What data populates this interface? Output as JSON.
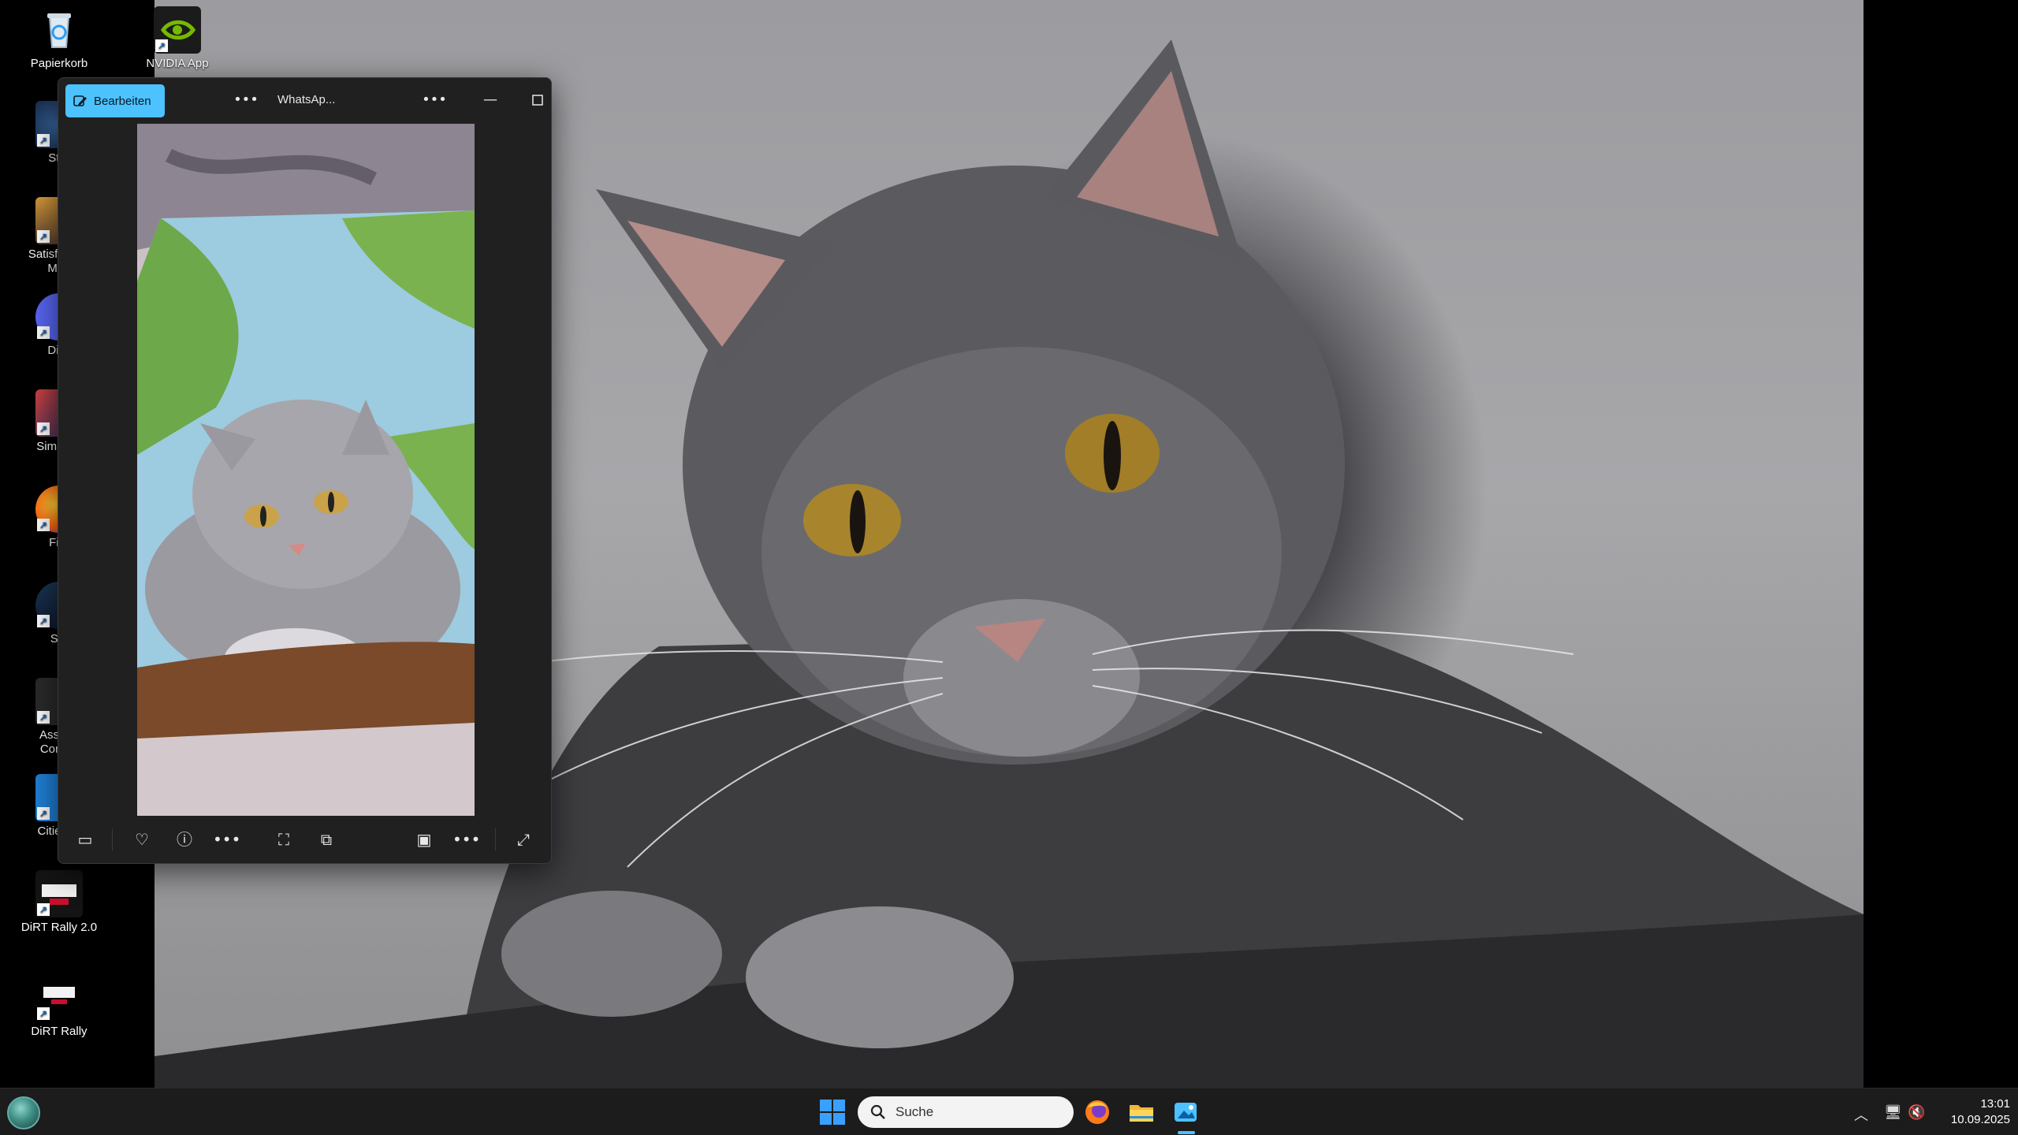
{
  "desktop": {
    "icons": [
      {
        "label": "Papierkorb",
        "icon": "recycle-bin-icon"
      },
      {
        "label": "NVIDIA App",
        "icon": "nvidia-icon"
      },
      {
        "label": "Star",
        "icon": "star-citizen-icon"
      },
      {
        "label": "Satisfactory",
        "icon": "satisfactory-icon",
        "label2": "Man"
      },
      {
        "label": "Disc",
        "icon": "discord-icon"
      },
      {
        "label": "SimPro I",
        "icon": "simpro-icon"
      },
      {
        "label": "Fire",
        "icon": "firefox-icon"
      },
      {
        "label": "Ste",
        "icon": "steam-icon"
      },
      {
        "label": "Assetto",
        "icon": "assetto-corsa-icon",
        "label2": "Compe"
      },
      {
        "label": "Cities Sl",
        "icon": "cities-skylines-icon"
      },
      {
        "label": "DiRT Rally 2.0",
        "icon": "dirt-rally-2-icon"
      },
      {
        "label": "DiRT Rally",
        "icon": "dirt-rally-icon"
      }
    ]
  },
  "photos_window": {
    "edit_label": "Bearbeiten",
    "title": "WhatsAp...",
    "colors": {
      "accent": "#4cc2ff",
      "background": "#202020"
    }
  },
  "taskbar": {
    "search_placeholder": "Suche",
    "time": "13:01",
    "date": "10.09.2025",
    "accent": "#3aa0ff"
  }
}
